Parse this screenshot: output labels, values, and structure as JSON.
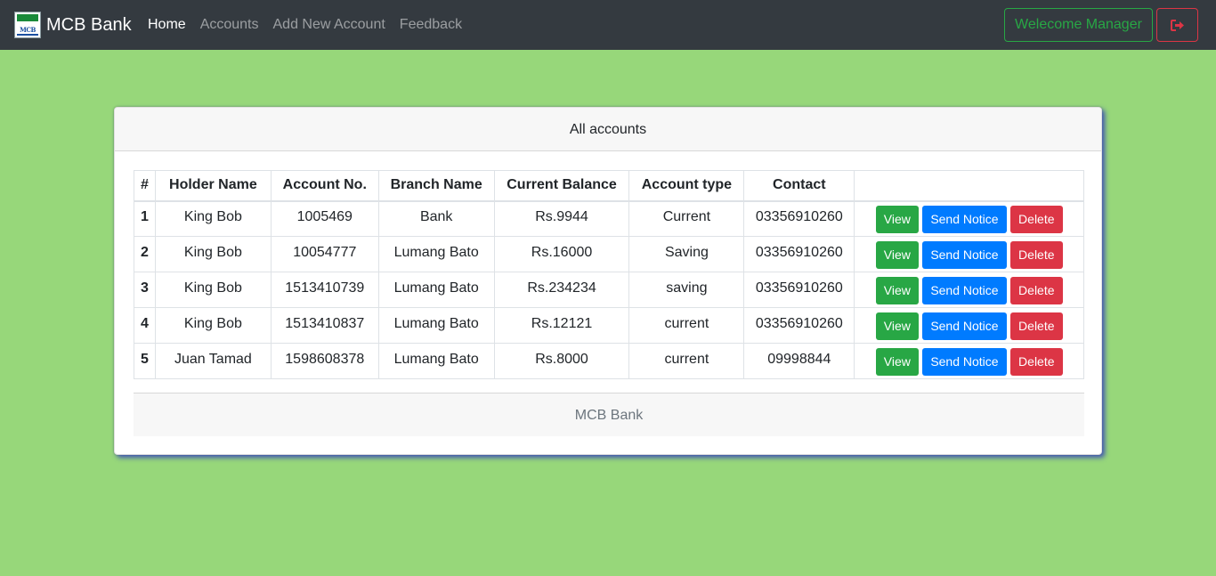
{
  "navbar": {
    "logo_text": "MCB",
    "brand": "MCB Bank",
    "links": [
      "Home",
      "Accounts",
      "Add New Account",
      "Feedback"
    ],
    "welcome": "Welecome Manager",
    "logout_icon": "sign-out-icon"
  },
  "card": {
    "header": "All accounts",
    "columns": [
      "#",
      "Holder Name",
      "Account No.",
      "Branch Name",
      "Current Balance",
      "Account type",
      "Contact",
      ""
    ],
    "rows": [
      {
        "num": "1",
        "name": "King Bob",
        "account": "1005469",
        "branch": "Bank",
        "balance": "Rs.9944",
        "type": "Current",
        "contact": "03356910260"
      },
      {
        "num": "2",
        "name": "King Bob",
        "account": "10054777",
        "branch": "Lumang Bato",
        "balance": "Rs.16000",
        "type": "Saving",
        "contact": "03356910260"
      },
      {
        "num": "3",
        "name": "King Bob",
        "account": "1513410739",
        "branch": "Lumang Bato",
        "balance": "Rs.234234",
        "type": "saving",
        "contact": "03356910260"
      },
      {
        "num": "4",
        "name": "King Bob",
        "account": "1513410837",
        "branch": "Lumang Bato",
        "balance": "Rs.12121",
        "type": "current",
        "contact": "03356910260"
      },
      {
        "num": "5",
        "name": "Juan Tamad",
        "account": "1598608378",
        "branch": "Lumang Bato",
        "balance": "Rs.8000",
        "type": "current",
        "contact": "09998844"
      }
    ],
    "actions": {
      "view": "View",
      "notice": "Send Notice",
      "delete": "Delete"
    },
    "footer": "MCB Bank"
  },
  "colors": {
    "page_bg": "#97d77a",
    "navbar_bg": "#343a40",
    "success": "#28a745",
    "primary": "#007bff",
    "danger": "#dc3545",
    "card_shadow": "#3f51b5"
  }
}
